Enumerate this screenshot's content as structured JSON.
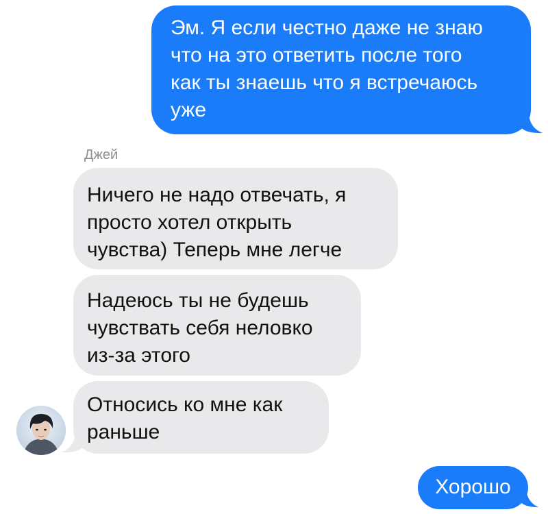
{
  "conversation": {
    "sender_name": "Джей",
    "messages": [
      {
        "direction": "outgoing",
        "text": "Эм. Я если честно даже не знаю\nчто на это ответить после того\nкак ты знаешь что я встречаюсь\nуже"
      },
      {
        "direction": "incoming",
        "text": "Ничего не надо отвечать, я\nпросто хотел открыть\nчувства) Теперь мне легче"
      },
      {
        "direction": "incoming",
        "text": "Надеюсь ты не будешь\nчувствать себя неловко\nиз-за этого"
      },
      {
        "direction": "incoming",
        "text": "Относись ко мне как\nраньше"
      },
      {
        "direction": "outgoing",
        "text": "Хорошо"
      }
    ]
  },
  "colors": {
    "outgoing_bubble": "#1a7cf8",
    "incoming_bubble": "#e9e9eb",
    "sender_name": "#8e8e93"
  },
  "icons": {
    "avatar": "contact-avatar-photo"
  }
}
